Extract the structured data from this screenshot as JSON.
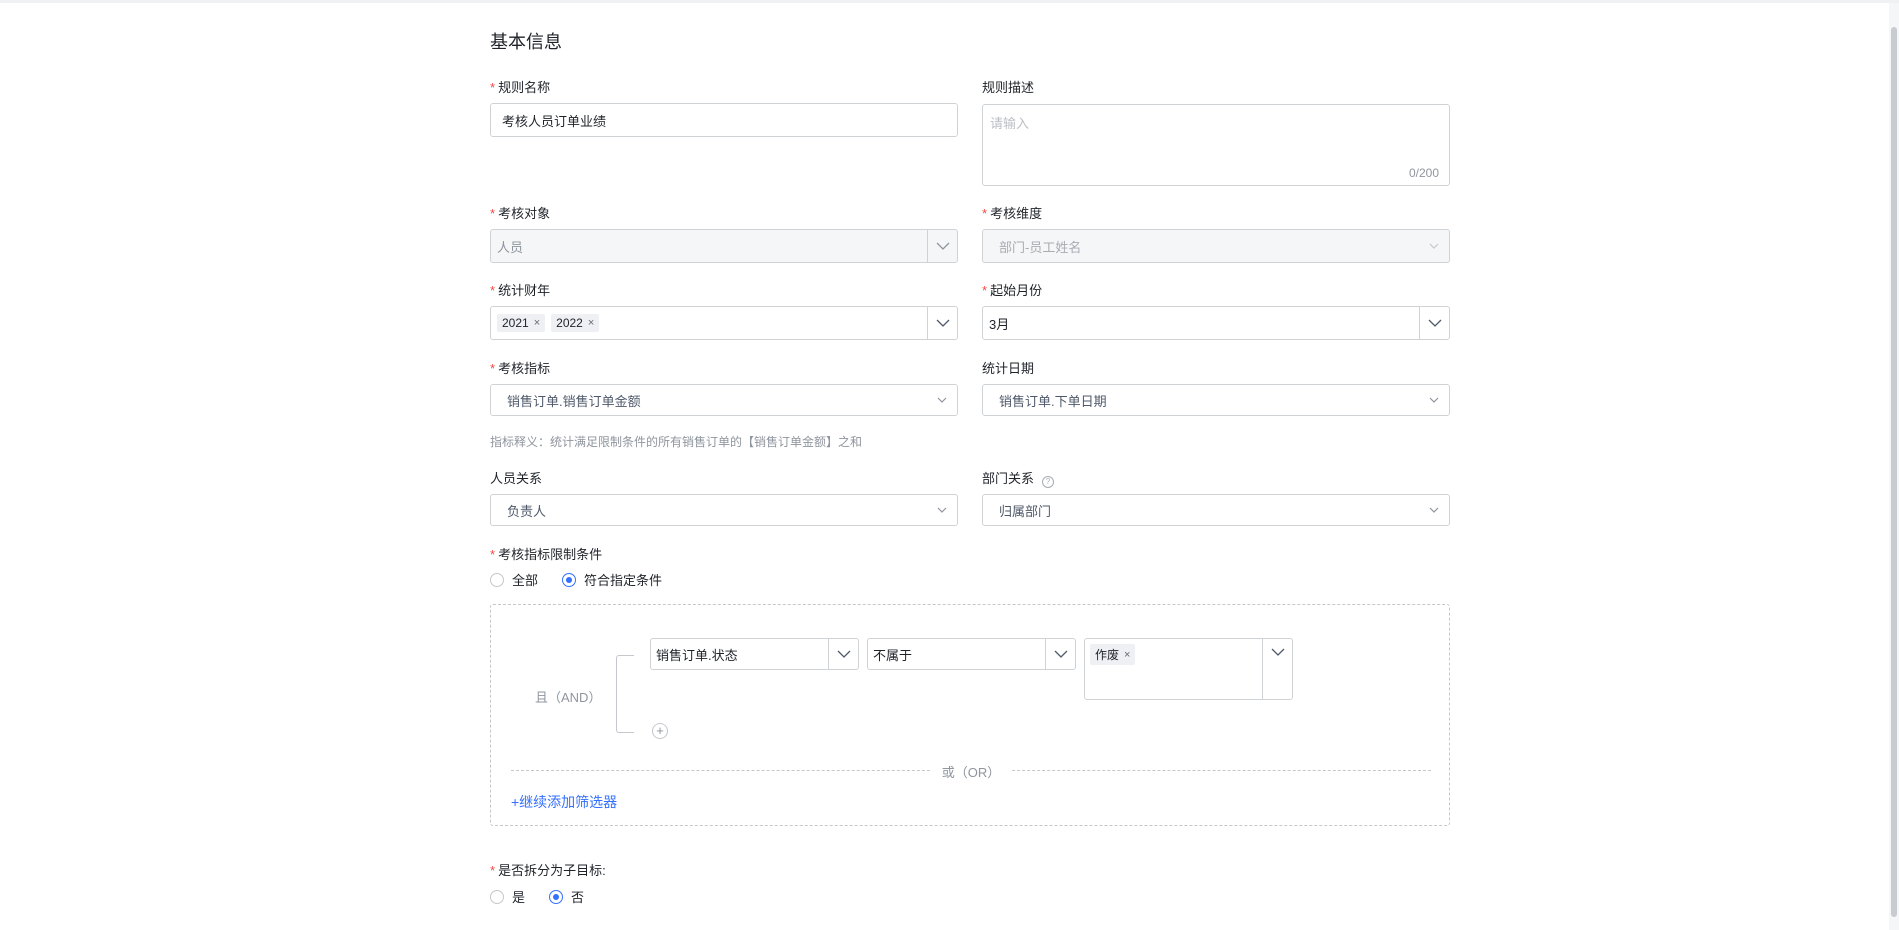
{
  "section": {
    "title": "基本信息"
  },
  "rule_name": {
    "label": "规则名称",
    "required": "*",
    "value": "考核人员订单业绩"
  },
  "rule_desc": {
    "label": "规则描述",
    "placeholder": "请输入",
    "count": "0/200"
  },
  "assess_object": {
    "label": "考核对象",
    "required": "*",
    "value": "人员"
  },
  "assess_dimension": {
    "label": "考核维度",
    "required": "*",
    "value": "部门-员工姓名"
  },
  "fiscal_year": {
    "label": "统计财年",
    "required": "*",
    "tags": [
      "2021",
      "2022"
    ],
    "remove": "×"
  },
  "start_month": {
    "label": "起始月份",
    "required": "*",
    "value": "3月"
  },
  "indicator": {
    "label": "考核指标",
    "required": "*",
    "value": "销售订单.销售订单金额"
  },
  "stat_date": {
    "label": "统计日期",
    "value": "销售订单.下单日期"
  },
  "indicator_hint": "指标释义：统计满足限制条件的所有销售订单的【销售订单金额】之和",
  "person_relation": {
    "label": "人员关系",
    "value": "负责人"
  },
  "dept_relation": {
    "label": "部门关系",
    "help": "?",
    "value": "归属部门"
  },
  "condition": {
    "label": "考核指标限制条件",
    "required": "*",
    "options": [
      "全部",
      "符合指定条件"
    ],
    "selected": 1
  },
  "filter": {
    "and_label": "且（AND）",
    "field": "销售订单.状态",
    "operator": "不属于",
    "value_tag": "作废",
    "remove": "×",
    "add_row": "+",
    "or_label": "或（OR）",
    "add_filter": "+继续添加筛选器"
  },
  "split": {
    "label": "是否拆分为子目标:",
    "required": "*",
    "options": [
      "是",
      "否"
    ],
    "selected": 1
  },
  "colors": {
    "primary": "#3370ff",
    "required": "#f54a45",
    "border": "#d0d3d6",
    "muted": "#8f959e"
  },
  "icons": {
    "select_arrow": "chevron-down-icon",
    "tag_remove": "close-icon",
    "help": "question-circle-icon"
  }
}
